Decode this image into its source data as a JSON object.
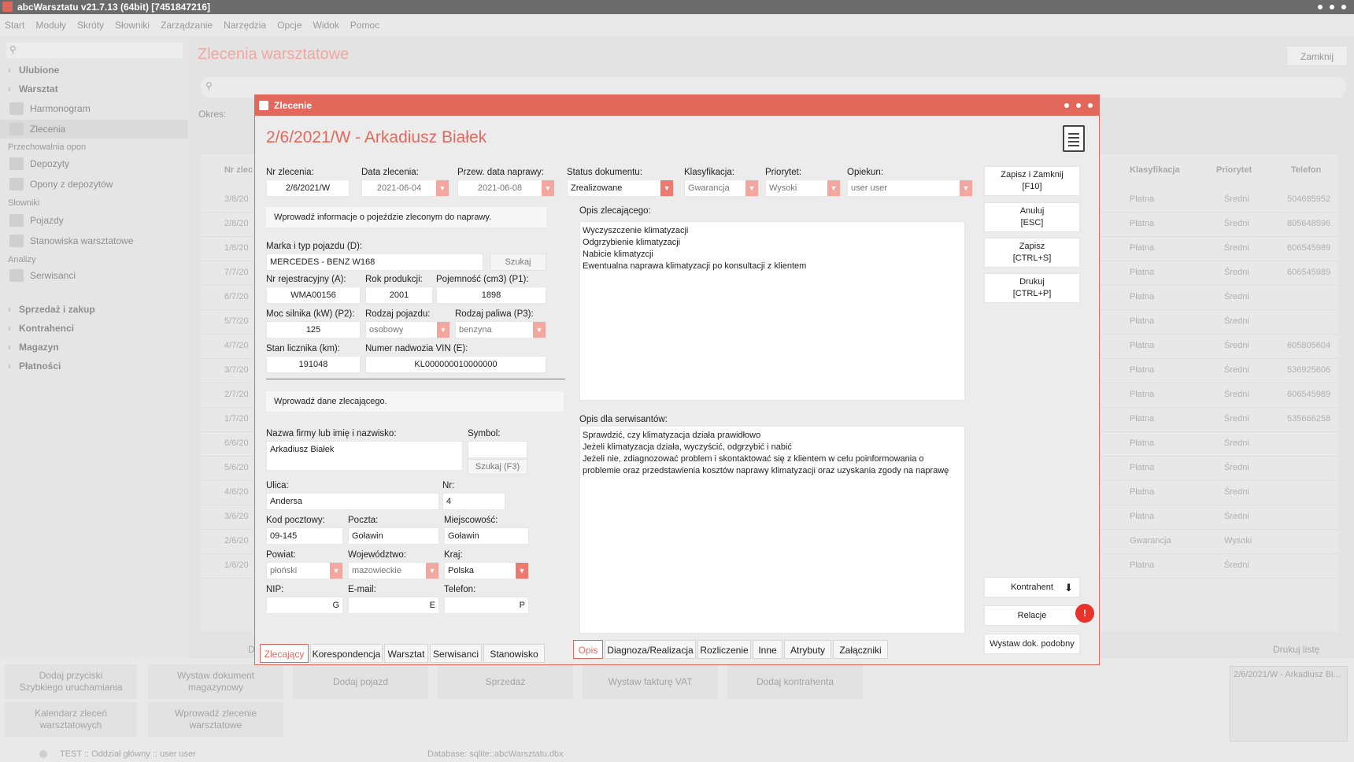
{
  "window": {
    "title": "abcWarsztatu v21.7.13 (64bit) [7451847216]"
  },
  "menu": [
    "Start",
    "Moduły",
    "Skróty",
    "Słowniki",
    "Zarządzanie",
    "Narzędzia",
    "Opcje",
    "Widok",
    "Pomoc"
  ],
  "sidebar": {
    "ulubione": "Ulubione",
    "warsztat": "Warsztat",
    "harmonogram": "Harmonogram",
    "zlecenia": "Zlecenia",
    "przechowalnia": "Przechowalnia opon",
    "depozyty": "Depozyty",
    "opony": "Opony z depozytów",
    "slowniki": "Słowniki",
    "pojazdy": "Pojazdy",
    "stanowiska": "Stanowiska warsztatowe",
    "analizy": "Analizy",
    "serwisanci": "Serwisanci",
    "sprzedaz": "Sprzedaż i zakup",
    "kontrahenci": "Kontrahenci",
    "magazyn": "Magazyn",
    "platnosci": "Płatności"
  },
  "main": {
    "title": "Zlecenia warsztatowe",
    "close": "Zamknij",
    "okres": "Okres:",
    "print_list": "Drukuj listę",
    "d_label": "D"
  },
  "grid": {
    "headers": {
      "nr": "Nr zlec",
      "klasyfikacja": "Klasyfikacja",
      "priorytet": "Priorytet",
      "telefon": "Telefon"
    },
    "rows": [
      {
        "nr": "3/8/20",
        "klas": "Płatna",
        "prio": "Średni",
        "tel": "504685952"
      },
      {
        "nr": "2/8/20",
        "klas": "Płatna",
        "prio": "Średni",
        "tel": "805648596"
      },
      {
        "nr": "1/8/20",
        "klas": "Płatna",
        "prio": "Średni",
        "tel": "606545989"
      },
      {
        "nr": "7/7/20",
        "klas": "Płatna",
        "prio": "Średni",
        "tel": "606545989"
      },
      {
        "nr": "6/7/20",
        "klas": "Płatna",
        "prio": "Średni",
        "tel": ""
      },
      {
        "nr": "5/7/20",
        "klas": "Płatna",
        "prio": "Średni",
        "tel": ""
      },
      {
        "nr": "4/7/20",
        "klas": "Płatna",
        "prio": "Średni",
        "tel": "605805604"
      },
      {
        "nr": "3/7/20",
        "klas": "Płatna",
        "prio": "Średni",
        "tel": "536925606"
      },
      {
        "nr": "2/7/20",
        "klas": "Płatna",
        "prio": "Średni",
        "tel": "606545989"
      },
      {
        "nr": "1/7/20",
        "klas": "Płatna",
        "prio": "Średni",
        "tel": "535666258"
      },
      {
        "nr": "6/6/20",
        "klas": "Płatna",
        "prio": "Średni",
        "tel": ""
      },
      {
        "nr": "5/6/20",
        "klas": "Płatna",
        "prio": "Średni",
        "tel": ""
      },
      {
        "nr": "4/6/20",
        "klas": "Płatna",
        "prio": "Średni",
        "tel": ""
      },
      {
        "nr": "3/6/20",
        "klas": "Płatna",
        "prio": "Średni",
        "tel": ""
      },
      {
        "nr": "2/6/20",
        "klas": "Gwarancja",
        "prio": "Wysoki",
        "tel": ""
      },
      {
        "nr": "1/6/20",
        "klas": "Płatna",
        "prio": "Średni",
        "tel": ""
      }
    ]
  },
  "bottom": {
    "b1": "Dodaj przyciski\nSzybkiego uruchamiania",
    "b2": "Wystaw dokument\nmagazynowy",
    "b3": "Dodaj pojazd",
    "b4": "Sprzedaż",
    "b5": "Wystaw fakturę VAT",
    "b6": "Dodaj kontrahenta",
    "b7": "Kalendarz zleceń\nwarsztatowych",
    "b8": "Wprowadź zlecenie\nwarsztatowe",
    "status": "TEST :: Oddział główny :: user user",
    "database": "Database: sqlite::abcWarsztatu.dbx",
    "thumb": "2/6/2021/W - Arkadiusz Bi..."
  },
  "dialog": {
    "title": "Zlecenie",
    "heading": "2/6/2021/W - Arkadiusz Białek",
    "nr_label": "Nr zlecenia:",
    "nr": "2/6/2021/W",
    "data_label": "Data zlecenia:",
    "data": "2021-06-04",
    "przew_label": "Przew. data naprawy:",
    "przew": "2021-06-08",
    "status_label": "Status dokumentu:",
    "status": "Zrealizowane",
    "klas_label": "Klasyfikacja:",
    "klas": "Gwarancja",
    "prio_label": "Priorytet:",
    "prio": "Wysoki",
    "opiekun_label": "Opiekun:",
    "opiekun": "user user",
    "vehicle_note": "Wprowadź informacje o pojeździe zleconym do naprawy.",
    "marka_label": "Marka i typ pojazdu (D):",
    "marka": "MERCEDES - BENZ W168",
    "szukaj": "Szukaj",
    "rej_label": "Nr rejestracyjny (A):",
    "rej": "WMA00156",
    "rok_label": "Rok produkcji:",
    "rok": "2001",
    "poj_label": "Pojemność (cm3) (P1):",
    "poj": "1898",
    "moc_label": "Moc silnika (kW) (P2):",
    "moc": "125",
    "rodzaj_label": "Rodzaj pojazdu:",
    "rodzaj": "osobowy",
    "paliwo_label": "Rodzaj paliwa (P3):",
    "paliwo": "benzyna",
    "licznik_label": "Stan licznika (km):",
    "licznik": "191048",
    "vin_label": "Numer nadwozia VIN (E):",
    "vin": "KL000000010000000",
    "client_note": "Wprowadź dane zlecającego.",
    "nazwa_label": "Nazwa firmy lub imię i nazwisko:",
    "nazwa": "Arkadiusz Białek",
    "symbol_label": "Symbol:",
    "szukaj_f3": "Szukaj (F3)",
    "ulica_label": "Ulica:",
    "ulica": "Andersa",
    "nrd_label": "Nr:",
    "nrd": "4",
    "kod_label": "Kod pocztowy:",
    "kod": "09-145",
    "poczta_label": "Poczta:",
    "poczta": "Goławin",
    "miejsc_label": "Miejscowość:",
    "miejsc": "Goławin",
    "powiat_label": "Powiat:",
    "powiat": "płoński",
    "woj_label": "Województwo:",
    "woj": "mazowieckie",
    "kraj_label": "Kraj:",
    "kraj": "Polska",
    "nip_label": "NIP:",
    "nip_btn": "G",
    "email_label": "E-mail:",
    "email_btn": "E",
    "tel_label": "Telefon:",
    "tel_btn": "P",
    "left_tabs": [
      "Zlecający",
      "Korespondencja",
      "Warsztat",
      "Serwisanci",
      "Stanowisko"
    ],
    "opis_label": "Opis zlecającego:",
    "opis": "Wyczyszczenie klimatyzacji\nOdgrzybienie klimatyzacji\nNabicie klimatyzcji\nEwentualna naprawa klimatyzacji po konsultacji z klientem",
    "opis_serw_label": "Opis dla serwisantów:",
    "opis_serw": "Sprawdzić, czy klimatyzacja działa prawidłowo\nJeżeli klimatyzacja działa, wyczyścić, odgrzybić i nabić\nJeżeli nie, zdiagnozować problem i skontaktować się z klientem w celu poinformowania o problemie oraz przedstawienia kosztów naprawy klimatyzacji oraz uzyskania zgody na naprawę",
    "right_tabs": [
      "Opis",
      "Diagnoza/Realizacja",
      "Rozliczenie",
      "Inne",
      "Atrybuty",
      "Załączniki"
    ],
    "btn_zapisz_zamknij": "Zapisz i Zamknij\n[F10]",
    "btn_anuluj": "Anuluj\n[ESC]",
    "btn_zapisz": "Zapisz\n[CTRL+S]",
    "btn_drukuj": "Drukuj\n[CTRL+P]",
    "btn_kontrahent": "Kontrahent",
    "btn_relacje": "Relacje",
    "btn_wystaw": "Wystaw dok. podobny"
  },
  "colors": {
    "accent": "#e3685c"
  }
}
